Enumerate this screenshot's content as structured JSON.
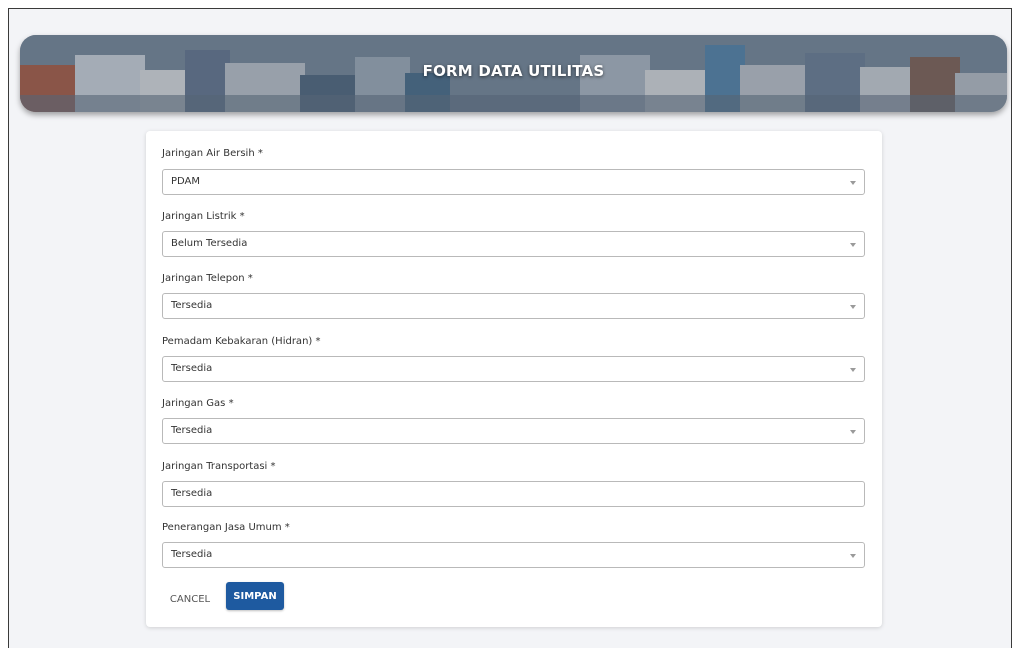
{
  "banner": {
    "title": "FORM DATA UTILITAS"
  },
  "form": {
    "fields": [
      {
        "label": "Jaringan Air Bersih *",
        "value": "PDAM",
        "type": "select"
      },
      {
        "label": "Jaringan Listrik *",
        "value": "Belum Tersedia",
        "type": "select"
      },
      {
        "label": "Jaringan Telepon *",
        "value": "Tersedia",
        "type": "select"
      },
      {
        "label": "Pemadam Kebakaran (Hidran) *",
        "value": "Tersedia",
        "type": "select"
      },
      {
        "label": "Jaringan Gas *",
        "value": "Tersedia",
        "type": "select"
      },
      {
        "label": "Jaringan Transportasi *",
        "value": "Tersedia",
        "type": "input"
      },
      {
        "label": "Penerangan Jasa Umum *",
        "value": "Tersedia",
        "type": "select"
      }
    ],
    "buttons": {
      "cancel_label": "CANCEL",
      "save_label": "SIMPAN"
    }
  },
  "colors": {
    "primary_button": "#1e5aa0",
    "background": "#f3f4f7",
    "card": "#ffffff"
  },
  "icons": {
    "dropdown": "chevron-down-icon"
  }
}
